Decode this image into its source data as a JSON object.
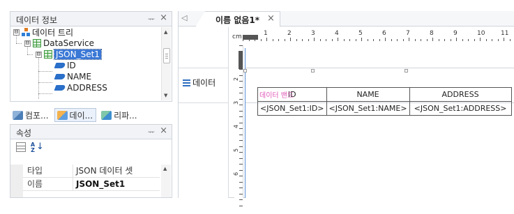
{
  "data_panel": {
    "title": "데이터 정보",
    "pin_glyph": "ᅲ",
    "close_glyph": "×",
    "tree": [
      {
        "label": "데이터 트리",
        "expander": "⊟"
      },
      {
        "label": "DataService",
        "expander": "⊟"
      },
      {
        "label": "JSON_Set1",
        "expander": "⊟",
        "selected": true
      },
      {
        "label": "ID"
      },
      {
        "label": "NAME"
      },
      {
        "label": "ADDRESS"
      }
    ]
  },
  "bottom_tabs": [
    {
      "label": "컴포...",
      "active": false
    },
    {
      "label": "데이...",
      "active": true
    },
    {
      "label": "리파...",
      "active": false
    }
  ],
  "properties_panel": {
    "title": "속성",
    "pin_glyph": "ᅲ",
    "close_glyph": "×",
    "sort_glyph": "A Z",
    "sort_arrow": "↓",
    "rows": [
      {
        "key": "타입",
        "value": "JSON 데이터 셋"
      },
      {
        "key": "이름",
        "value": "JSON_Set1"
      }
    ]
  },
  "editor": {
    "nav_glyph": "◁",
    "doc_tab": {
      "label": "이름 없음1*",
      "close_glyph": "×"
    },
    "ruler_unit": "cm",
    "ruler_top_numbers": [
      "1",
      "2",
      "3",
      "4",
      "5",
      "6",
      "7",
      "8",
      "9",
      "10",
      "11"
    ],
    "ruler_left_numbers": [
      "2",
      "3",
      "4",
      "5",
      "6"
    ],
    "band_label": "데이터",
    "table": {
      "overlay_label": "데이터 밴드",
      "headers": [
        "ID",
        "NAME",
        "ADDRESS"
      ],
      "cells": [
        "<JSON_Set1:ID>",
        "<JSON_Set1:NAME>",
        "<JSON_Set1:ADDRESS>"
      ]
    }
  },
  "colors": {
    "selection": "#3a78d6",
    "page_guide": "#5a8fd6",
    "overlay_label": "#e05ab8"
  }
}
